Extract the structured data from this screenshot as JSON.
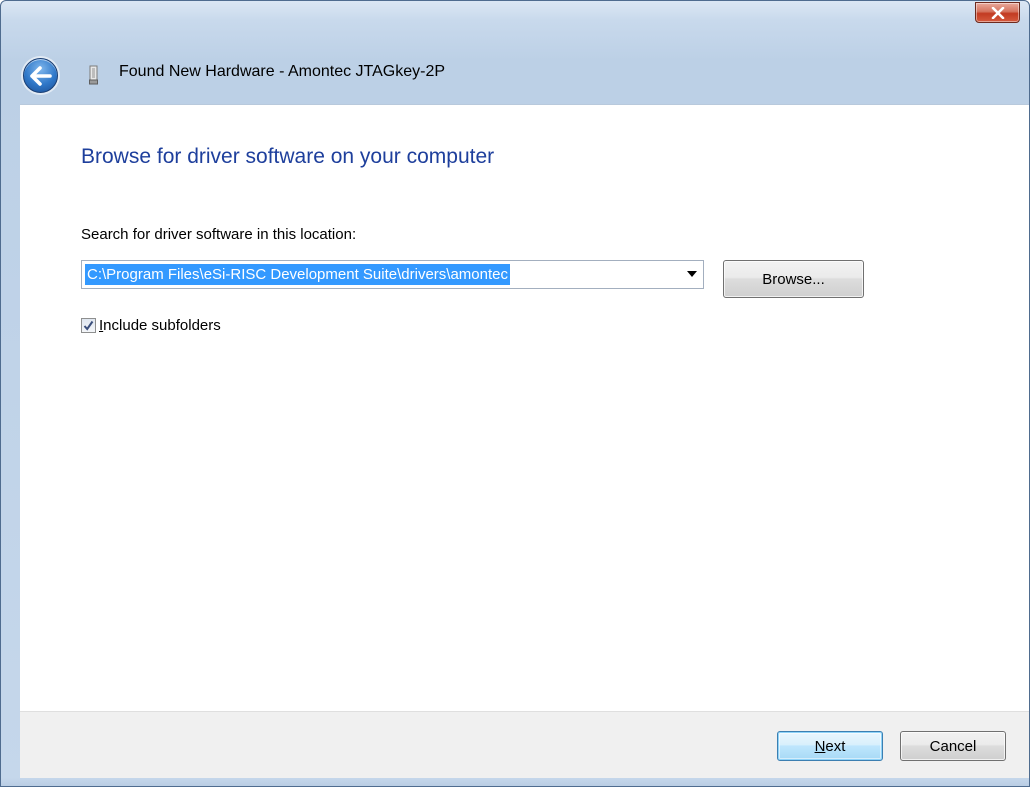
{
  "window": {
    "title": "Found New Hardware - Amontec JTAGkey-2P"
  },
  "icons": {
    "close": "close-icon",
    "back": "back-arrow-icon",
    "hardware": "hardware-device-icon",
    "checkmark": "checkmark-icon",
    "dropdown": "chevron-down-icon"
  },
  "main": {
    "heading": "Browse for driver software on your computer",
    "search_label": "Search for driver software in this location:",
    "location_value": "C:\\Program Files\\eSi-RISC Development Suite\\drivers\\amontec",
    "browse_label": "Browse...",
    "include_subfolders_label": "Include subfolders",
    "include_subfolders_checked": true
  },
  "footer": {
    "next_label": "Next",
    "cancel_label": "Cancel"
  },
  "colors": {
    "heading": "#1e3f9c",
    "selection": "#3399ff",
    "frame": "#c8d9ec"
  }
}
